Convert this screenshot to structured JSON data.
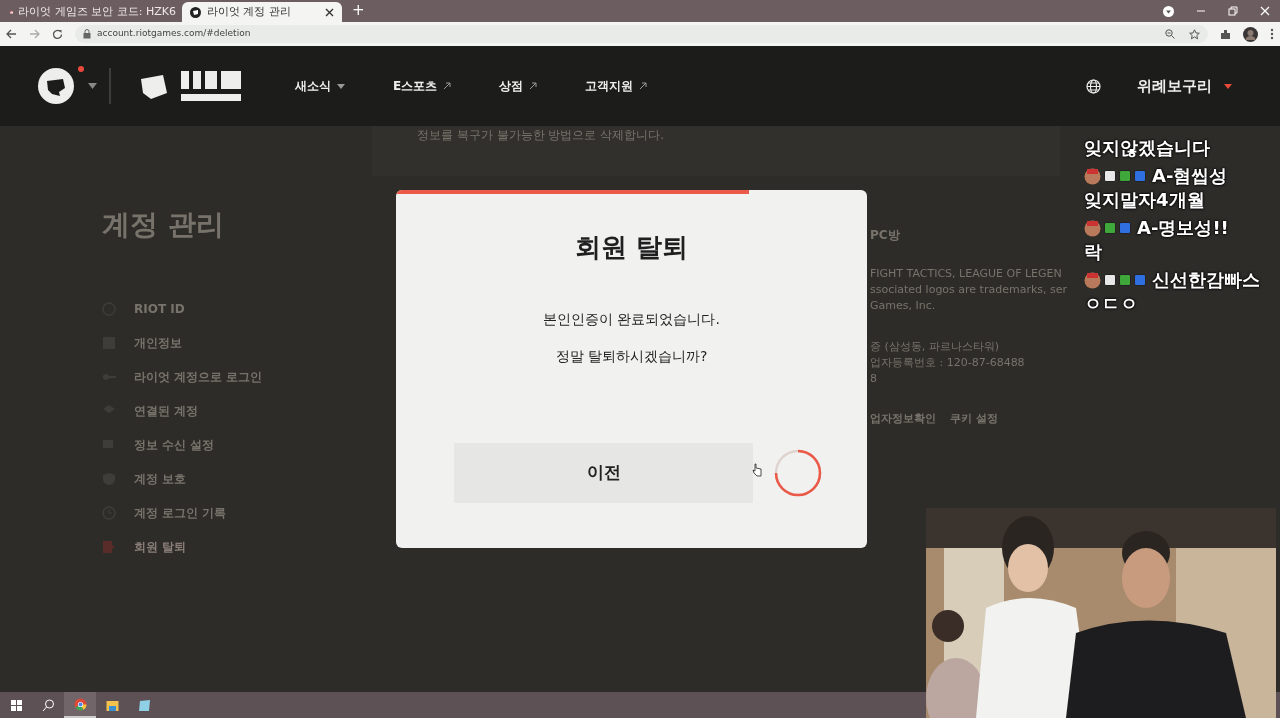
{
  "browser": {
    "tabs": [
      {
        "title": "라이엇 게임즈 보안 코드: HZK6",
        "selected": false
      },
      {
        "title": "라이엇 계정 관리",
        "selected": true
      }
    ],
    "new_tab": "+",
    "url": "account.riotgames.com/#deletion"
  },
  "header": {
    "notification": true,
    "nav": [
      {
        "label": "새소식",
        "kind": "dropdown"
      },
      {
        "label": "E스포츠",
        "kind": "external"
      },
      {
        "label": "상점",
        "kind": "external"
      },
      {
        "label": "고객지원",
        "kind": "external"
      }
    ],
    "user": "위례보구리"
  },
  "page": {
    "title": "계정 관리",
    "sidebar": [
      {
        "label": "RIOT ID",
        "selected": false
      },
      {
        "label": "개인정보",
        "selected": false
      },
      {
        "label": "라이엇 계정으로 로그인",
        "selected": false
      },
      {
        "label": "연결된 계정",
        "selected": false
      },
      {
        "label": "정보 수신 설정",
        "selected": false
      },
      {
        "label": "계정 보호",
        "selected": false
      },
      {
        "label": "계정 로그인 기록",
        "selected": false
      },
      {
        "label": "회원 탈퇴",
        "selected": true
      }
    ],
    "notice": "정보를 복구가 불가능한 방법으로 삭제합니다.",
    "footer": {
      "heading": "PC방",
      "legal": [
        "FIGHT TACTICS, LEAGUE OF LEGEN",
        "ssociated logos are trademarks, ser",
        "Games, Inc."
      ],
      "address": [
        "증 (삼성동, 파르나스타워)",
        "업자등록번호 : 120-87-68488",
        "8"
      ],
      "links": [
        "업자정보확인",
        "쿠키 설정"
      ]
    }
  },
  "modal": {
    "title": "회원 탈퇴",
    "level": 0.75,
    "messages": [
      "본인인증이 완료되었습니다.",
      "정말 탈퇴하시겠습니까?"
    ],
    "back_button": "이전",
    "loading": true
  },
  "chat": [
    {
      "message": "잊지않겠습니다"
    },
    {
      "user": "A-혐씹성",
      "message": "잊지말자4개월",
      "badges": [
        {
          "color": "#e8e8e8"
        },
        {
          "color": "#3fa83a"
        },
        {
          "color": "#2f6fe0"
        }
      ]
    },
    {
      "user": "A-명보성!!",
      "message": "락",
      "badges": [
        {
          "color": "#3fa83a"
        },
        {
          "color": "#2f6fe0"
        }
      ]
    },
    {
      "user": "신선한감빠스",
      "message": "ㅇㄷㅇ",
      "badges": [
        {
          "color": "#e8e8e8"
        },
        {
          "color": "#3fa83a"
        },
        {
          "color": "#2f6fe0"
        }
      ]
    }
  ],
  "taskbar": [
    {
      "kind": "start",
      "selected": false
    },
    {
      "kind": "search",
      "selected": false
    },
    {
      "kind": "chrome",
      "selected": true
    },
    {
      "kind": "explorer",
      "selected": false
    },
    {
      "kind": "app",
      "selected": false
    }
  ]
}
